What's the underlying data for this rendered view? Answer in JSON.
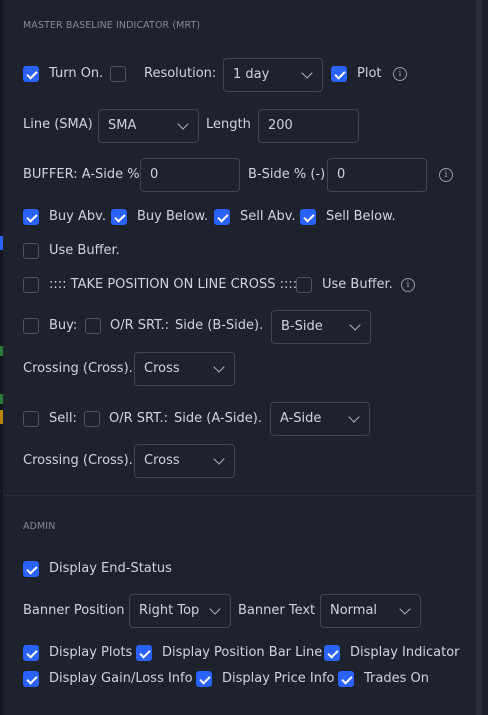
{
  "section_master": "MASTER BASELINE INDICATOR (MRT)",
  "row1": {
    "turn_on": "Turn On.",
    "resolution_label": "Resolution:",
    "resolution_value": "1 day",
    "plot": "Plot"
  },
  "row2": {
    "line_label": "Line (SMA)",
    "line_value": "SMA",
    "length_label": "Length",
    "length_value": "200"
  },
  "row3": {
    "buffer_a_label": "BUFFER: A-Side %",
    "buffer_a_value": "0",
    "buffer_b_label": "B-Side % (-)",
    "buffer_b_value": "0"
  },
  "row4": {
    "buy_abv": "Buy Abv.",
    "buy_below": "Buy Below.",
    "sell_abv": "Sell Abv.",
    "sell_below": "Sell Below."
  },
  "row5": {
    "use_buffer": "Use Buffer."
  },
  "row6": {
    "take_position": ":::: TAKE POSITION ON LINE CROSS ::::",
    "use_buffer": "Use Buffer."
  },
  "row7": {
    "buy": "Buy:",
    "or_srt": "O/R SRT.:",
    "side_label": "Side (B-Side).",
    "side_value": "B-Side"
  },
  "row8": {
    "crossing_label": "Crossing (Cross).",
    "crossing_value": "Cross"
  },
  "row9": {
    "sell": "Sell:",
    "or_srt": "O/R SRT.:",
    "side_label": "Side (A-Side).",
    "side_value": "A-Side"
  },
  "row10": {
    "crossing_label": "Crossing (Cross).",
    "crossing_value": "Cross"
  },
  "section_admin": "ADMIN",
  "row11": {
    "display_end_status": "Display End-Status"
  },
  "row12": {
    "banner_position_label": "Banner Position",
    "banner_position_value": "Right Top",
    "banner_text_label": "Banner Text",
    "banner_text_value": "Normal"
  },
  "row13": {
    "display_plots": "Display Plots",
    "display_position_bar_line": "Display Position Bar Line",
    "display_indicator": "Display Indicator"
  },
  "row14": {
    "display_gain_loss": "Display Gain/Loss Info",
    "display_price_info": "Display Price Info",
    "trades_on": "Trades On"
  },
  "checked": {
    "turn_on": true,
    "resolution": false,
    "plot": true,
    "buy_abv": true,
    "buy_below": true,
    "sell_abv": true,
    "sell_below": true,
    "use_buffer": false,
    "take_position": false,
    "take_use_buffer": false,
    "buy": false,
    "buy_or_srt": false,
    "sell": false,
    "sell_or_srt": false,
    "display_end_status": true,
    "display_plots": true,
    "display_position_bar_line": true,
    "display_indicator": true,
    "display_gain_loss": true,
    "display_price_info": true,
    "trades_on": true
  },
  "colors": {
    "background": "#1e222d",
    "accent": "#2962ff",
    "text": "#d1d4dc",
    "muted": "#868993"
  }
}
